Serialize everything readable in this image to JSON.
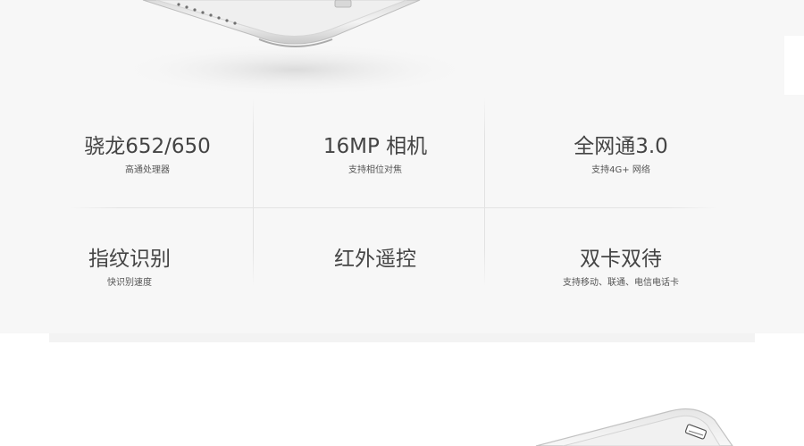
{
  "specs": [
    {
      "title": "骁龙652/650",
      "subtitle": "高通处理器"
    },
    {
      "title": "16MP 相机",
      "subtitle": "支持相位对焦"
    },
    {
      "title": "全网通3.0",
      "subtitle": "支持4G+ 网络"
    },
    {
      "title": "指纹识别",
      "subtitle": "快识别速度"
    },
    {
      "title": "红外遥控",
      "subtitle": ""
    },
    {
      "title": "双卡双待",
      "subtitle": "支持移动、联通、电信电话卡"
    }
  ],
  "images": {
    "top": "phone-bottom-edge",
    "bottom": "phone-top-corner"
  }
}
